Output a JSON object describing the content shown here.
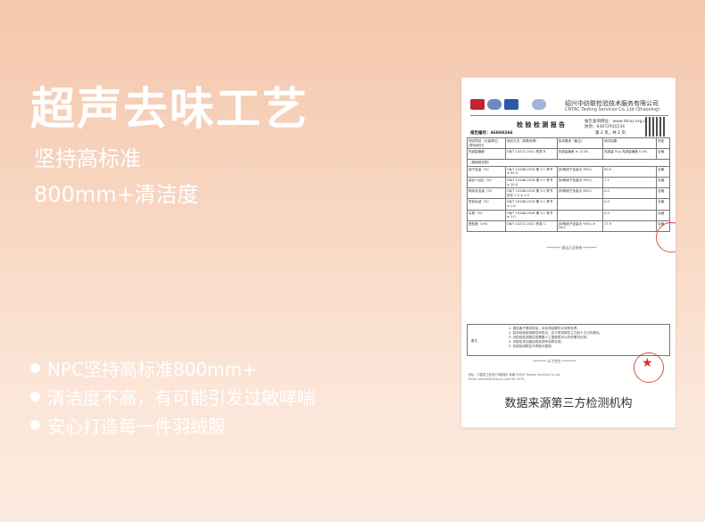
{
  "hero": {
    "title": "超声去味工艺",
    "subtitle_line1": "坚持高标准",
    "subtitle_line2": "800mm+清洁度"
  },
  "bullets": [
    "NPC坚持高标准800mm+",
    "清洁度不高，有可能引发过敏哮喘",
    "安心打造每一件羽绒服"
  ],
  "report": {
    "org_cn": "绍兴中纺联检验技术服务有限公司",
    "org_en": "CNTAC Testing Services Co.,Ltd (Shaoxing)",
    "heading": "检 验 检 测 报 告",
    "site_line": "报告查询网址：www.fdcaz.org.cn",
    "phone_line": "防伪：64872910234",
    "serial": "报告编号：46069266",
    "page_info": "第 2 页，共 2 页",
    "table": {
      "headers": [
        "测试项目（计量单位）[样品标识]",
        "测试方法（参数说明）",
        "技术要求（备注）",
        "测试结果",
        "判定"
      ],
      "section": "（原绒填充物）",
      "rows": [
        [
          "充绒量偏差",
          "GB/T 14272-2021 附录 B",
          "充绒量偏差 ≥ -5.0%",
          "充绒量 91g 充绒量偏差 0.4%",
          "合格"
        ],
        [
          "绒子含量（%）",
          "GB/T 10288-2016 第 5.1 条节 ≥ 90.0",
          "(标明绒子含量为 90%)",
          "90.5",
          "合格"
        ],
        [
          "绒丝+羽丝（%）",
          "GB/T 10288-2016 第 5.1 条节 ≤ 10.0",
          "(标明绒子含量为 90%)",
          "7.1",
          "合格"
        ],
        [
          "鸭毛毛含量（%）",
          "GB/T 10288-2016 第 5.1 条节 至仅 1.0 ≤ 1.0",
          "(标明绒子含量为 60%)",
          "0.0",
          "合格"
        ],
        [
          "异色毛绒（%）",
          "GB/T 10288-2016 第 5.1 条节 ≤ 1.0",
          "",
          "0.0",
          "合格"
        ],
        [
          "杂质（%）",
          "GB/T 10288-2016 第 5.1 条节 ≤ 1.0",
          "",
          "0.0",
          "合格"
        ],
        [
          "蓬松度（cm）",
          "GB/T 14272-2021 附录 C",
          "(标明绒子含量为 90%) ≥ 16.0",
          "17.9",
          "合格"
        ]
      ]
    },
    "end_mark": "******** 报告正文结束 ********",
    "notes_label": "备注",
    "notes": [
      "1. 报告客户提供样品，本检测结果仅对来样负责。",
      "2. 若对检验检测报告有异议，应于收到报告之日起十五日内提出。",
      "3. 对检验检测报告如需要人工复核签字以外的情况无效。",
      "4. 本报告未加盖检验检测专用章无效。",
      "5. 检验检测报告不得部分复制。"
    ],
    "blank_mark": "******** 以下空白 ********",
    "footer1": "地址：中国浙江省绍兴市越城区 邮编 CNTAC Testing Services Co.,Ltd",
    "footer2": "Email: service@cntac-sx.com  Tel: 0575-",
    "caption": "数据来源第三方检测机构"
  }
}
